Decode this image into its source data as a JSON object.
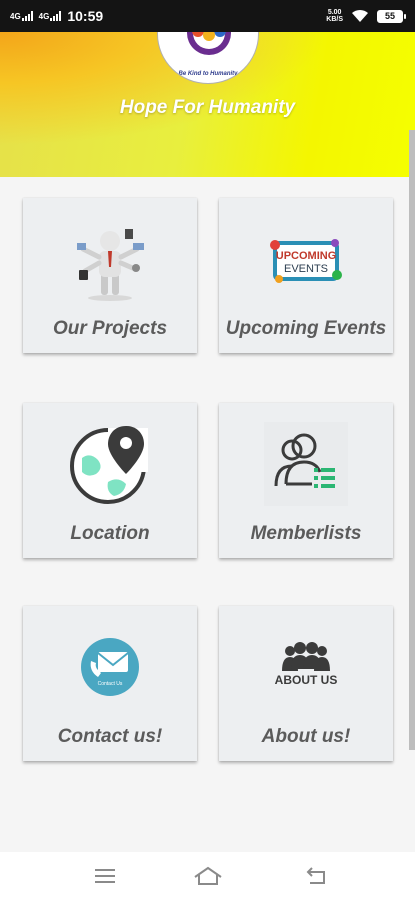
{
  "status": {
    "time": "10:59",
    "sim1": "4G",
    "sim2": "4G",
    "net_speed_value": "5.00",
    "net_speed_unit": "KB/S",
    "battery": "55"
  },
  "header": {
    "title": "Hope For Humanity",
    "logo_tagline": "Be Kind to Humanity"
  },
  "tiles": [
    {
      "label": "Our Projects",
      "icon": "businessman-multitask-icon"
    },
    {
      "label": "Upcoming Events",
      "icon": "upcoming-events-badge-icon",
      "badge_line1": "UPCOMING",
      "badge_line2": "EVENTS"
    },
    {
      "label": "Location",
      "icon": "location-globe-pin-icon"
    },
    {
      "label": "Memberlists",
      "icon": "members-list-icon"
    },
    {
      "label": "Contact us!",
      "icon": "contact-envelope-phone-icon",
      "badge_text": "Contact Us"
    },
    {
      "label": "About us!",
      "icon": "about-us-group-icon",
      "badge_text": "ABOUT US"
    }
  ],
  "nav": {
    "menu_icon": "menu-icon",
    "home_icon": "home-icon",
    "back_icon": "back-icon"
  },
  "colors": {
    "header_orange": "#f3a51a",
    "header_yellow": "#f5ff00",
    "card_bg": "#edeff1",
    "label_gray": "#5b5b5b",
    "location_green": "#7fe3c3",
    "member_green": "#2bb673",
    "contact_teal": "#4aa7c2"
  }
}
